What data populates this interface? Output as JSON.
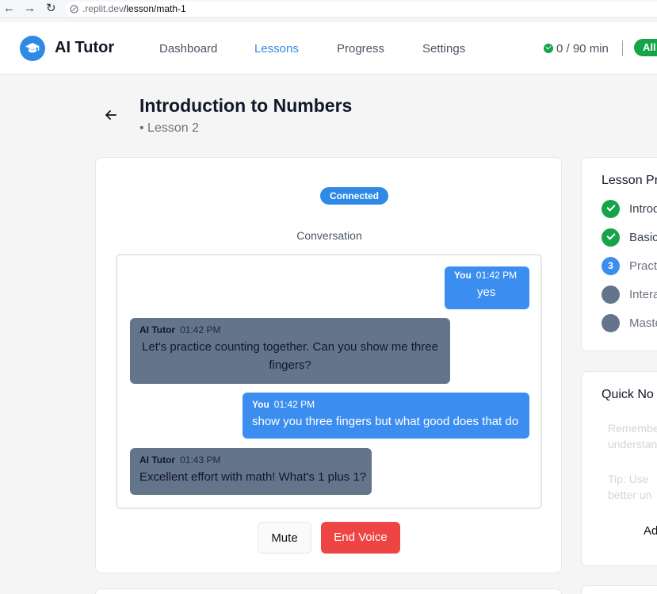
{
  "browser": {
    "back": "←",
    "forward": "→",
    "reload": "↻",
    "url_host": ".replit.dev",
    "url_path": "/lesson/math-1"
  },
  "header": {
    "brand": "AI Tutor",
    "nav": [
      "Dashboard",
      "Lessons",
      "Progress",
      "Settings"
    ],
    "active_nav": "Lessons",
    "timer": "0 / 90 min",
    "plan_badge": "All"
  },
  "lesson": {
    "title": "Introduction to Numbers",
    "subtitle": "• Lesson 2"
  },
  "conversation": {
    "status": "Connected",
    "label": "Conversation",
    "messages": [
      {
        "sender": "You",
        "time": "01:42 PM",
        "text": "yes",
        "role": "user"
      },
      {
        "sender": "AI Tutor",
        "time": "01:42 PM",
        "text": "Let's practice counting together. Can you show me three fingers?",
        "role": "tutor"
      },
      {
        "sender": "You",
        "time": "01:42 PM",
        "text": "show you three fingers but what good does that do",
        "role": "user"
      },
      {
        "sender": "AI Tutor",
        "time": "01:43 PM",
        "text": "Excellent effort with math! What's 1 plus 1?",
        "role": "tutor"
      }
    ],
    "mute_label": "Mute",
    "end_label": "End Voice"
  },
  "lesson_progress": {
    "title": "Lesson Pr",
    "steps": [
      {
        "label": "Introd",
        "state": "done"
      },
      {
        "label": "Basic",
        "state": "done"
      },
      {
        "label": "Pract",
        "state": "current",
        "number": "3"
      },
      {
        "label": "Intera",
        "state": "todo"
      },
      {
        "label": "Maste",
        "state": "todo"
      }
    ]
  },
  "quick_notes": {
    "title": "Quick No",
    "placeholder_lines": [
      "Remembe",
      "understan",
      "Tip: Use",
      "better un"
    ],
    "add_label": "Ad"
  },
  "colors": {
    "accent": "#2f8ae6",
    "success": "#16a34a",
    "danger": "#ef4444",
    "tutor_bubble": "#64748b",
    "user_bubble": "#3b8ef0"
  }
}
